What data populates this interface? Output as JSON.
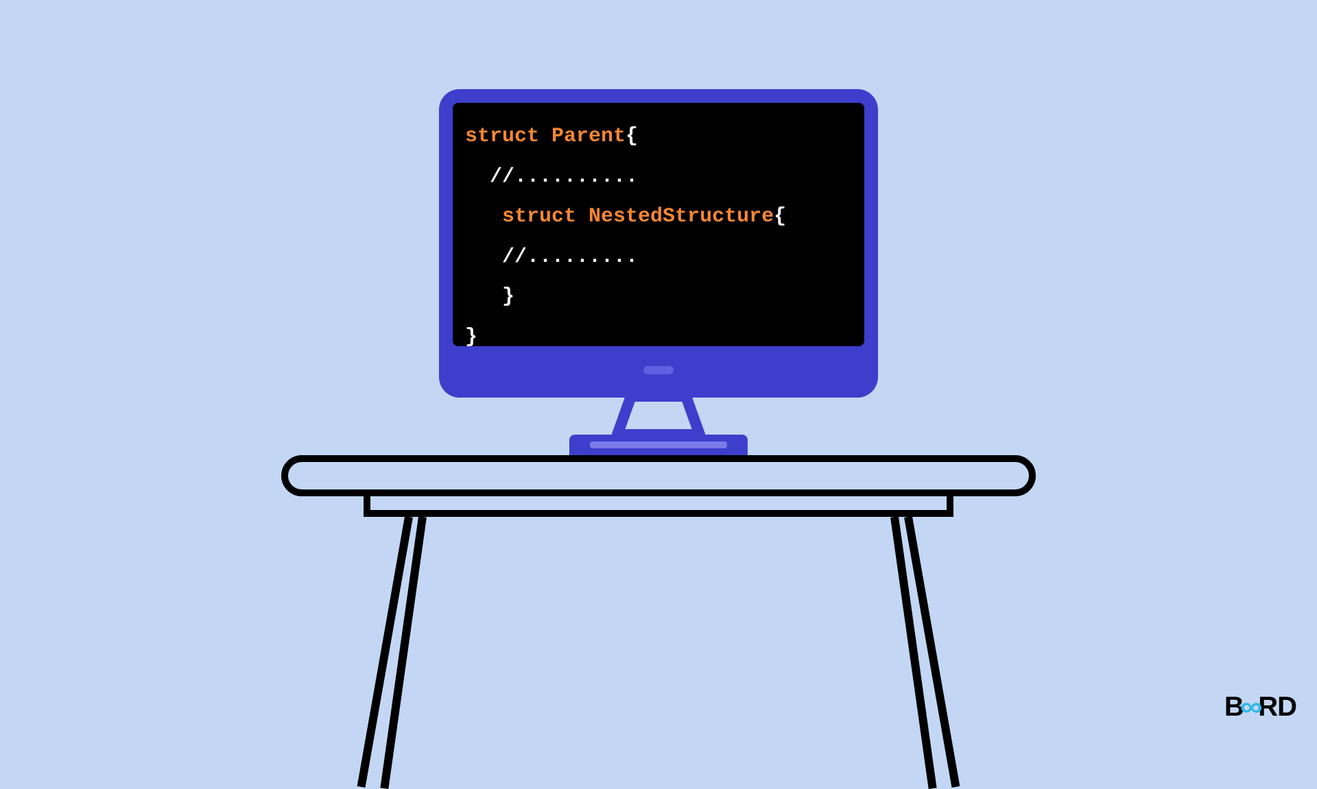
{
  "code": {
    "line1_kw": "struct Parent",
    "line1_brace": "{",
    "line2": "  //..........",
    "line3_indent": "   ",
    "line3_kw": "struct NestedStructure",
    "line3_brace": "{",
    "line4": "   //.........",
    "line5": "   }",
    "line6": "}"
  },
  "logo": {
    "part1": "B",
    "infinity": "∞",
    "part2": "RD"
  },
  "colors": {
    "background": "#c3d7f5",
    "monitor": "#3e3ecc",
    "screen": "#000000",
    "keyword": "#f58634",
    "table": "#000000",
    "logo_accent": "#2eb8e6"
  }
}
